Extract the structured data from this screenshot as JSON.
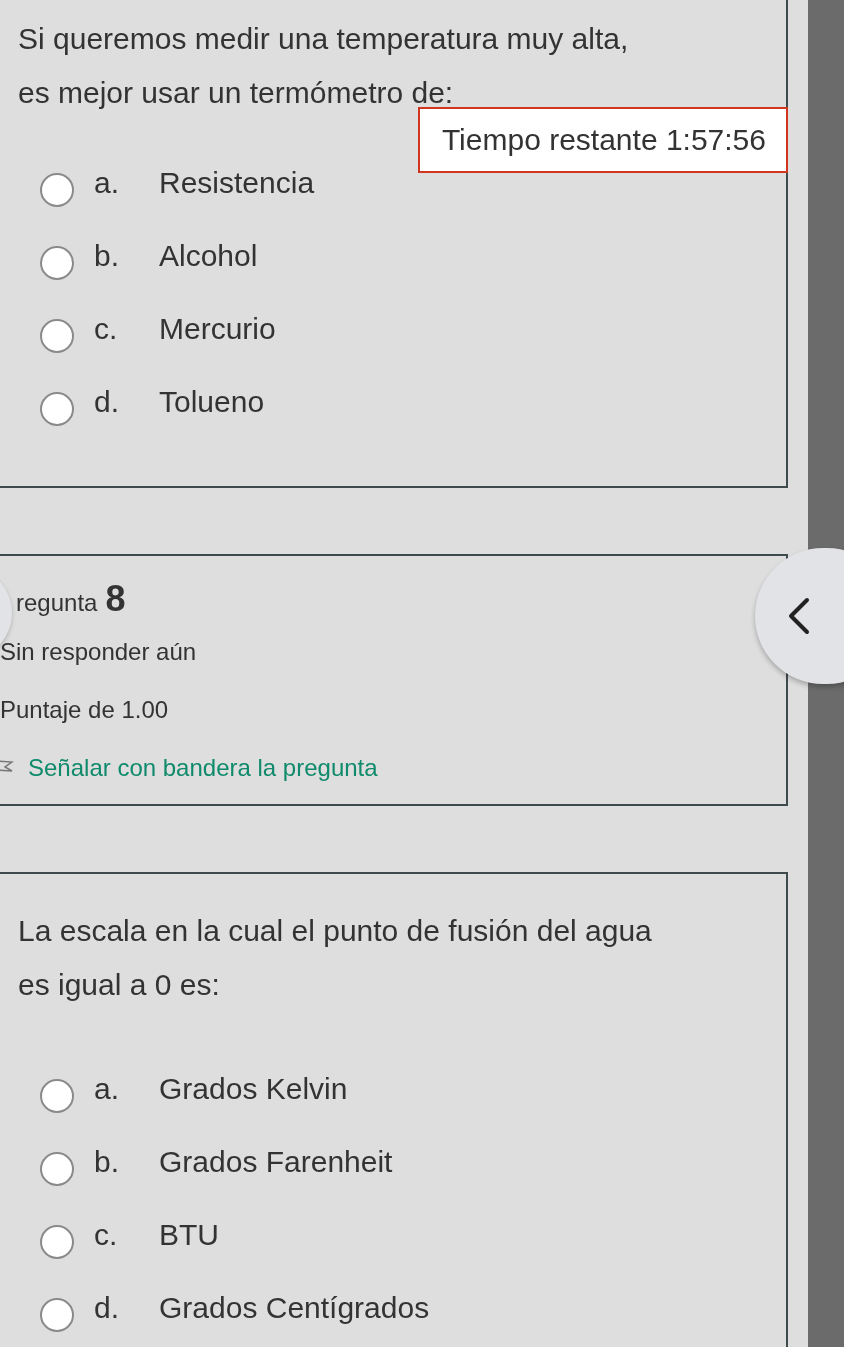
{
  "questions": [
    {
      "text": "Si queremos medir una temperatura muy alta, es mejor usar un termómetro de:",
      "timer": "Tiempo restante 1:57:56",
      "options": [
        {
          "letter": "a.",
          "label": "Resistencia",
          "selected": false
        },
        {
          "letter": "b.",
          "label": "Alcohol",
          "selected": false
        },
        {
          "letter": "c.",
          "label": "Mercurio",
          "selected": false
        },
        {
          "letter": "d.",
          "label": "Tolueno",
          "selected": false
        }
      ]
    },
    {
      "info": {
        "title": "regunta",
        "number": "8",
        "status": "Sin responder aún",
        "score": "Puntaje de 1.00",
        "flag_link": "Señalar con bandera la pregunta",
        "flagged": false
      }
    },
    {
      "text": "La escala en la cual el punto de fusión del agua es igual a 0 es:",
      "options": [
        {
          "letter": "a.",
          "label": "Grados Kelvin",
          "selected": false
        },
        {
          "letter": "b.",
          "label": "Grados Farenheit",
          "selected": false
        },
        {
          "letter": "c.",
          "label": "BTU",
          "selected": false
        },
        {
          "letter": "d.",
          "label": "Grados Centígrados",
          "selected": false
        }
      ]
    }
  ]
}
